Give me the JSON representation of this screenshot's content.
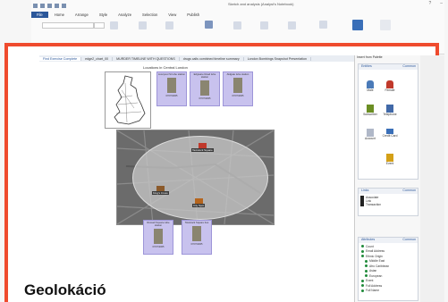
{
  "app": {
    "title": "Sketch and analysis (Analyst's Notebook)",
    "menu": [
      "File",
      "Home",
      "Arrange",
      "Style",
      "Analyze",
      "Selection",
      "View",
      "Publish"
    ],
    "ribbon_groups": [
      "Font",
      "Entity Style",
      "Link Style",
      "Emphasize",
      "Formatting"
    ]
  },
  "tabs": [
    "Find Exercise Complete",
    "edge2_chart_00",
    "MURDER TIMELINE WITH QUESTIONS",
    "drugs calls combined timeline summary",
    "London Bombings Snapshot Presentation"
  ],
  "chart": {
    "title": "Locations in Central London",
    "cards_top": [
      {
        "caption": "Liverpool St tube station",
        "date": "07/07/2005"
      },
      {
        "caption": "Edgware Road tube station",
        "date": "07/07/2005"
      },
      {
        "caption": "Aldgate tube station",
        "date": "07/07/2005"
      }
    ],
    "cards_bottom": [
      {
        "caption": "Russell Square tube station",
        "date": "07/07/2005"
      },
      {
        "caption": "Tavistock Square bus",
        "date": "07/07/2005"
      }
    ],
    "map_pins": [
      "Tavistock Square",
      "King's Cross",
      "City Spot"
    ]
  },
  "palette": {
    "header": "Insert from Palette",
    "entities_title": "Entities",
    "entities_filter": "Common",
    "entities": [
      "Male",
      "Female",
      "Subscriber",
      "Telephone",
      "Account",
      "Credit Card",
      "Event"
    ],
    "links_title": "Links",
    "links_filter": "Common",
    "links": [
      "Associate",
      "Link",
      "Transaction"
    ],
    "attributes_title": "Attributes",
    "attributes_filter": "Common",
    "attributes": [
      "Count",
      "Email Address",
      "Ethnic Origin",
      "Middle East",
      "Afro Caribbean",
      "Asian",
      "European",
      "Event",
      "Full Address",
      "Full Name"
    ]
  },
  "caption": "Geolokáció",
  "colors": {
    "frame": "#ef4b2e",
    "card": "#c8c2ee",
    "accent": "#2b579a"
  }
}
